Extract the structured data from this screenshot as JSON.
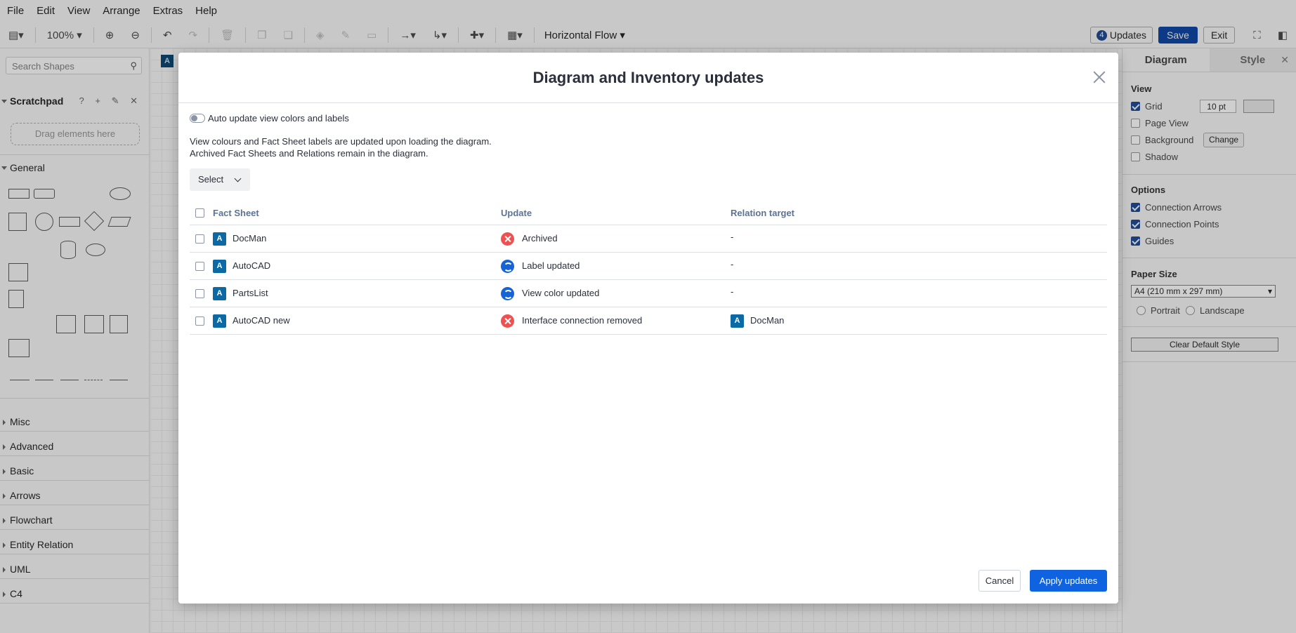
{
  "menu": [
    "File",
    "Edit",
    "View",
    "Arrange",
    "Extras",
    "Help"
  ],
  "toolbar": {
    "zoom": "100%",
    "flow": "Horizontal Flow",
    "updates_count": "4",
    "updates_label": "Updates",
    "save_label": "Save",
    "exit_label": "Exit"
  },
  "sidebar": {
    "search_placeholder": "Search Shapes",
    "scratchpad": "Scratchpad",
    "scratch_icons": "? + ✎ ✕",
    "drag_hint": "Drag elements here",
    "general": "General",
    "sections": [
      "Misc",
      "Advanced",
      "Basic",
      "Arrows",
      "Flowchart",
      "Entity Relation",
      "UML",
      "C4"
    ]
  },
  "canvas": {
    "fs_icon_letter": "A"
  },
  "rpanel": {
    "tab_diagram": "Diagram",
    "tab_style": "Style",
    "view_title": "View",
    "grid": "Grid",
    "grid_size": "10 pt",
    "page_view": "Page View",
    "background": "Background",
    "change": "Change",
    "shadow": "Shadow",
    "options_title": "Options",
    "connection_arrows": "Connection Arrows",
    "connection_points": "Connection Points",
    "guides": "Guides",
    "paper_size_title": "Paper Size",
    "paper_size": "A4 (210 mm x 297 mm)",
    "portrait": "Portrait",
    "landscape": "Landscape",
    "clear_style": "Clear Default Style"
  },
  "modal": {
    "title": "Diagram and Inventory updates",
    "toggle_label": "Auto update view colors and labels",
    "info1": "View colours and Fact Sheet labels are updated upon loading the diagram.",
    "info2": "Archived Fact Sheets and Relations remain in the diagram.",
    "select_label": "Select",
    "columns": {
      "fact_sheet": "Fact Sheet",
      "update": "Update",
      "relation_target": "Relation target"
    },
    "rows": [
      {
        "icon": "A",
        "name": "DocMan",
        "status": "archived",
        "update": "Archived",
        "target": "-",
        "target_icon": ""
      },
      {
        "icon": "A",
        "name": "AutoCAD",
        "status": "updated",
        "update": "Label updated",
        "target": "-",
        "target_icon": ""
      },
      {
        "icon": "A",
        "name": "PartsList",
        "status": "updated",
        "update": "View color updated",
        "target": "-",
        "target_icon": ""
      },
      {
        "icon": "A",
        "name": "AutoCAD new",
        "status": "removed",
        "update": "Interface connection removed",
        "target": "DocMan",
        "target_icon": "A"
      }
    ],
    "cancel_label": "Cancel",
    "apply_label": "Apply updates"
  },
  "colors": {
    "primary": "#0f63e0",
    "fact_sheet_icon": "#0b6aa5",
    "error": "#ef5050",
    "update": "#1563d6"
  }
}
